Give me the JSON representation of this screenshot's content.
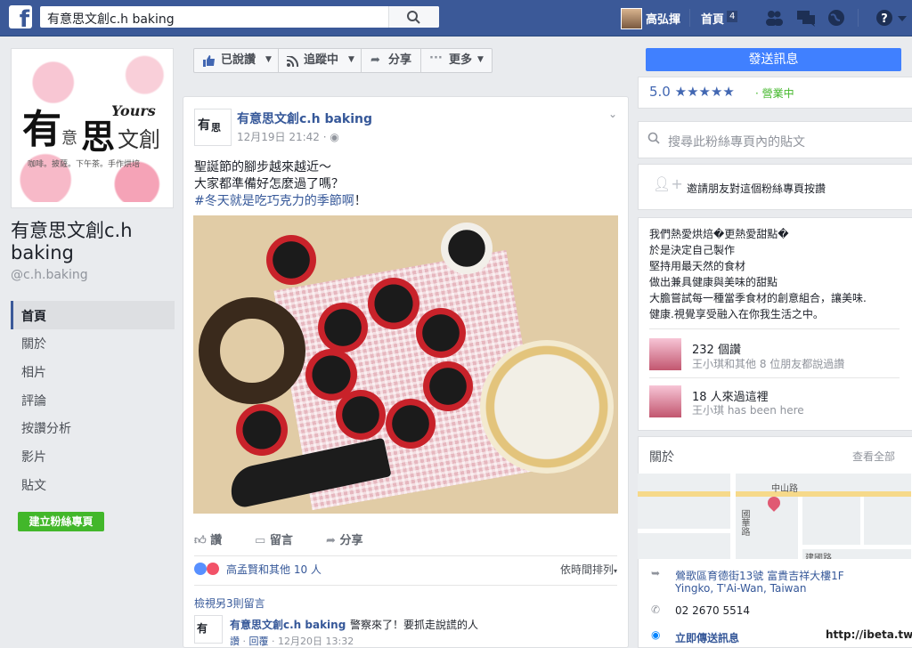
{
  "topbar": {
    "search_value": "有意思文創c.h baking",
    "user_name": "高弘揮",
    "home_label": "首頁",
    "home_count": "4"
  },
  "cover": {
    "logo_you": "有",
    "logo_yi": "意",
    "logo_si": "思",
    "logo_wenchuang": "文創",
    "logo_yours": "Yours",
    "tagline": "咖啡。披薩。下午茶。手作烘培"
  },
  "page": {
    "name": "有意思文創c.h baking",
    "handle": "@c.h.baking"
  },
  "left_nav": {
    "items": [
      "首頁",
      "關於",
      "相片",
      "評論",
      "按讚分析",
      "影片",
      "貼文"
    ],
    "create_page": "建立粉絲專頁"
  },
  "action_bar": {
    "liked": "已說讚",
    "following": "追蹤中",
    "share": "分享",
    "more": "更多"
  },
  "post": {
    "author": "有意思文創c.h baking",
    "time": "12月19日 21:42 · ",
    "line1": "聖誕節的腳步越來越近～",
    "line2": "大家都準備好怎麼過了嗎？",
    "hashtag": "#冬天就是吃巧克力的季節啊",
    "line3_end": "！",
    "like_action": "讚",
    "comment_action": "留言",
    "share_action": "分享",
    "reactions_text": "高孟賢和其他 10 人",
    "sort_label": "依時間排列",
    "view_more": "檢視另3則留言",
    "comment_author": "有意思文創c.h baking",
    "comment_text": "警察來了！要抓走說謊的人",
    "comment_like": "讚",
    "comment_reply": "回覆",
    "comment_time": "12月20日 13:32"
  },
  "right": {
    "send_message": "發送訊息",
    "rating": "5.0 ★★★★★",
    "open_now": "· 營業中",
    "page_search_placeholder": "搜尋此粉絲專頁內的貼文",
    "invite": "邀請朋友對這個粉絲專頁按讚",
    "about_lines": [
      "我們熱愛烘焙�更熱愛甜點�",
      "於是決定自己製作",
      "堅持用最天然的食材",
      "做出兼具健康與美味的甜點",
      "大膽嘗試每一種當季食材的創意組合，讓美味.",
      "健康.視覺享受融入在你我生活之中。"
    ],
    "likes_count": "232 個讚",
    "likes_sub": "王小琪和其他 8 位朋友都說過讚",
    "visits_count": "18 人來過這裡",
    "visits_sub": "王小琪 has been here",
    "about_title": "關於",
    "see_all": "查看全部",
    "map_labels": [
      "中山路",
      "國華路",
      "建國路"
    ],
    "address_line1": "鶯歌區育德街13號 富貴吉祥大樓1F",
    "address_line2": "Yingko, T'Ai-Wan, Taiwan",
    "phone": "02 2670 5514",
    "message_link": "立即傳送訊息"
  },
  "watermark": "http://ibeta.tw",
  "colors": {
    "brand": "#3b5998",
    "link": "#365899",
    "send_button": "#4080ff",
    "create_button": "#42b72a"
  }
}
